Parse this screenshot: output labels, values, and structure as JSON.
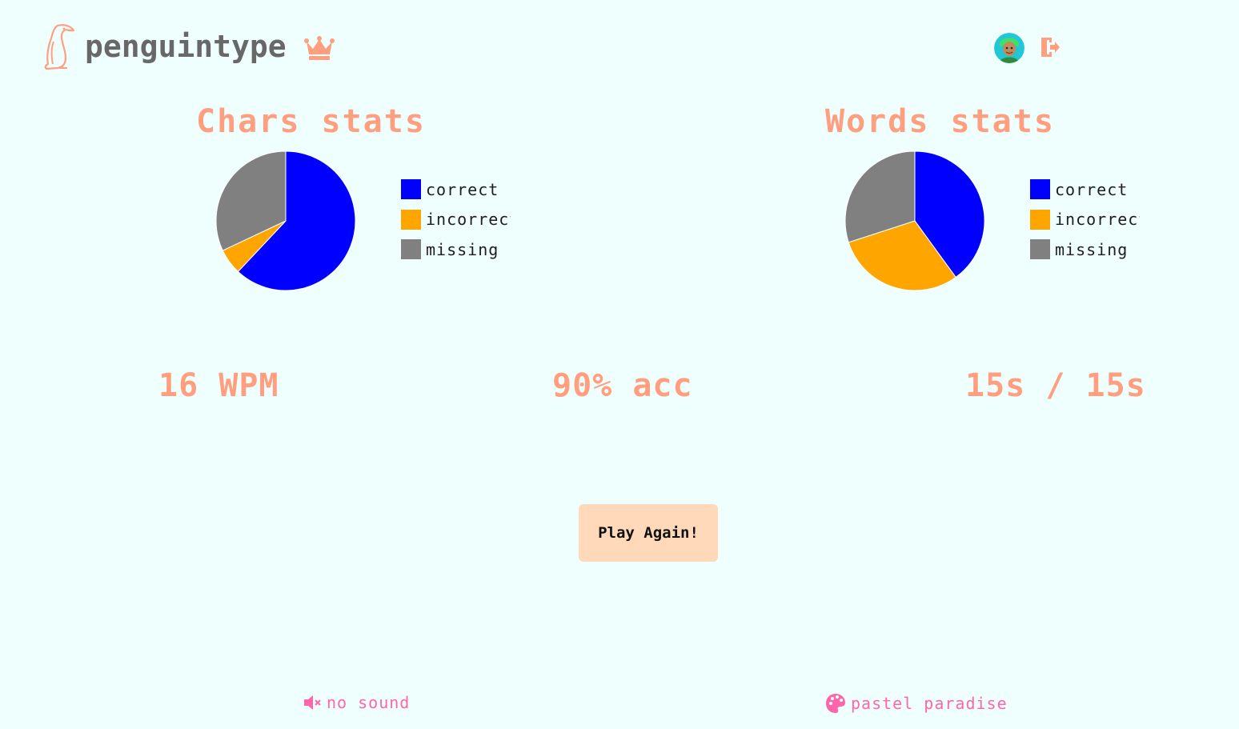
{
  "app": {
    "name": "penguintype"
  },
  "colors": {
    "accent": "#ff9f80",
    "logo_text": "#686868",
    "correct": "#0000ff",
    "incorrect": "#ffa500",
    "missing": "#808080",
    "footer": "#ff66aa",
    "button_bg": "#ffd9b9",
    "background": "#effffe"
  },
  "header": {
    "icons": [
      "penguin-logo-icon",
      "crown-icon",
      "avatar",
      "logout-icon"
    ]
  },
  "chars_stats": {
    "title": "Chars stats",
    "legend": [
      "correct",
      "incorrect",
      "missing"
    ]
  },
  "words_stats": {
    "title": "Words stats",
    "legend": [
      "correct",
      "incorrect",
      "missing"
    ]
  },
  "chart_data": [
    {
      "type": "pie",
      "title": "Chars stats",
      "categories": [
        "correct",
        "incorrect",
        "missing"
      ],
      "values": [
        62,
        6,
        32
      ],
      "colors": [
        "#0000ff",
        "#ffa500",
        "#808080"
      ],
      "legend": "right"
    },
    {
      "type": "pie",
      "title": "Words stats",
      "categories": [
        "correct",
        "incorrect",
        "missing"
      ],
      "values": [
        40,
        30,
        30
      ],
      "colors": [
        "#0000ff",
        "#ffa500",
        "#808080"
      ],
      "legend": "right"
    }
  ],
  "results": {
    "wpm": "16 WPM",
    "accuracy": "90% acc",
    "time": "15s / 15s"
  },
  "actions": {
    "play_again": "Play Again!"
  },
  "footer": {
    "sound": {
      "label": "no sound",
      "icon": "speaker-muted-icon"
    },
    "theme": {
      "label": "pastel paradise",
      "icon": "palette-icon"
    }
  }
}
